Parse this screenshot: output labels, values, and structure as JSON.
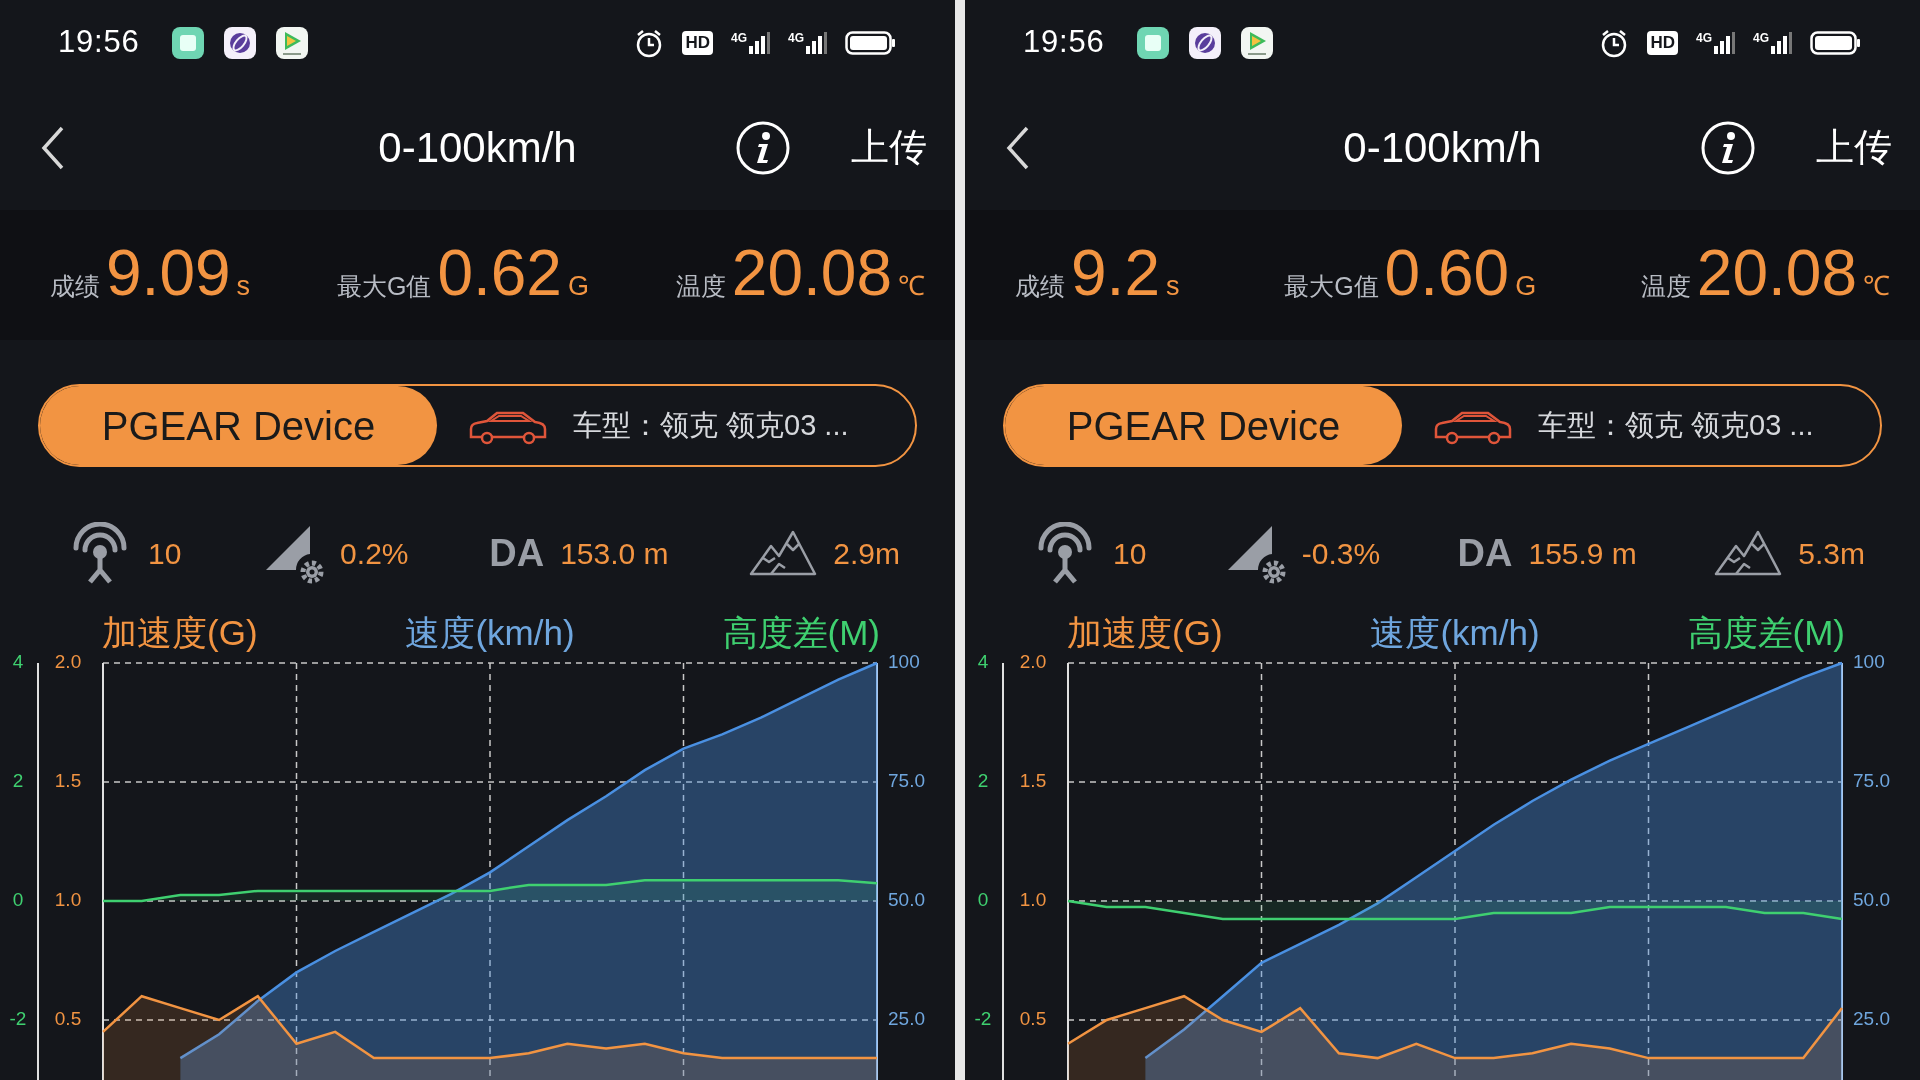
{
  "panels": [
    {
      "status_bar": {
        "time": "19:56",
        "hd_label": "HD",
        "signals": [
          "4G",
          "4G"
        ]
      },
      "header": {
        "title": "0-100km/h",
        "action": "上传"
      },
      "stats": [
        {
          "label": "成绩",
          "value": "9.09",
          "unit": "s"
        },
        {
          "label": "最大G值",
          "value": "0.62",
          "unit": "G"
        },
        {
          "label": "温度",
          "value": "20.08",
          "unit": "℃"
        }
      ],
      "device": {
        "name": "PGEAR Device",
        "car_model": "车型：领克 领克03 ..."
      },
      "metrics": [
        {
          "kind": "satellites",
          "value": "10"
        },
        {
          "kind": "slope",
          "value": "0.2%"
        },
        {
          "kind": "density_altitude",
          "label": "DA",
          "value": "153.0 m"
        },
        {
          "kind": "elevation",
          "value": "2.9m"
        }
      ],
      "chart": {
        "chart_data": {
          "type": "area",
          "grid": true,
          "categories": [
            null,
            null,
            null,
            null,
            null,
            null,
            null,
            null,
            null,
            null,
            null,
            null,
            null,
            null,
            null,
            null,
            null,
            null,
            null,
            null,
            null
          ],
          "ylim": [
            0,
            2
          ],
          "yticks": [
            {
              "value": 2,
              "label": "2.0"
            },
            {
              "value": 1.5,
              "label": "1.5"
            },
            {
              "value": 1,
              "label": "1.0"
            },
            {
              "value": 0.5,
              "label": "0.5"
            }
          ],
          "y2lim": [
            0,
            100
          ],
          "y2ticks": [
            {
              "value": 100,
              "label": "100"
            },
            {
              "value": 75,
              "label": "75.0"
            },
            {
              "value": 50,
              "label": "50.0"
            },
            {
              "value": 25,
              "label": "25.0"
            }
          ],
          "y3lim": [
            -4,
            4
          ],
          "y3ticks": [
            4,
            2,
            0,
            -2
          ],
          "series": [
            {
              "name": "加速度(G)",
              "color": "#f29442",
              "values": [
                0.45,
                0.6,
                0.55,
                0.5,
                0.6,
                0.4,
                0.45,
                0.34,
                0.34,
                0.34,
                0.34,
                0.36,
                0.4,
                0.38,
                0.4,
                0.36,
                0.34,
                0.34,
                0.34,
                0.34,
                0.34
              ]
            },
            {
              "name": "速度(km/h)",
              "color": "#4a90e2",
              "axis": "y2",
              "values": [
                null,
                null,
                17,
                22,
                29,
                35,
                39.5,
                43.5,
                47.5,
                51.5,
                56,
                61.5,
                67,
                72,
                77.5,
                82,
                85,
                88.5,
                92.5,
                96.5,
                100
              ]
            },
            {
              "name": "高度差(M)",
              "color": "#3fd070",
              "axis": "y3",
              "values": [
                0,
                0,
                0.1,
                0.1,
                0.17,
                0.17,
                0.17,
                0.17,
                0.17,
                0.17,
                0.17,
                0.27,
                0.27,
                0.27,
                0.35,
                0.35,
                0.35,
                0.35,
                0.35,
                0.35,
                0.3
              ]
            }
          ]
        }
      }
    },
    {
      "status_bar": {
        "time": "19:56",
        "hd_label": "HD",
        "signals": [
          "4G",
          "4G"
        ]
      },
      "header": {
        "title": "0-100km/h",
        "action": "上传"
      },
      "stats": [
        {
          "label": "成绩",
          "value": "9.2",
          "unit": "s"
        },
        {
          "label": "最大G值",
          "value": "0.60",
          "unit": "G"
        },
        {
          "label": "温度",
          "value": "20.08",
          "unit": "℃"
        }
      ],
      "device": {
        "name": "PGEAR Device",
        "car_model": "车型：领克 领克03 ..."
      },
      "metrics": [
        {
          "kind": "satellites",
          "value": "10"
        },
        {
          "kind": "slope",
          "value": "-0.3%"
        },
        {
          "kind": "density_altitude",
          "label": "DA",
          "value": "155.9 m"
        },
        {
          "kind": "elevation",
          "value": "5.3m"
        }
      ],
      "chart": {
        "chart_data": {
          "type": "area",
          "grid": true,
          "categories": [
            null,
            null,
            null,
            null,
            null,
            null,
            null,
            null,
            null,
            null,
            null,
            null,
            null,
            null,
            null,
            null,
            null,
            null,
            null,
            null,
            null
          ],
          "ylim": [
            0,
            2
          ],
          "yticks": [
            {
              "value": 2,
              "label": "2.0"
            },
            {
              "value": 1.5,
              "label": "1.5"
            },
            {
              "value": 1,
              "label": "1.0"
            },
            {
              "value": 0.5,
              "label": "0.5"
            }
          ],
          "y2lim": [
            0,
            100
          ],
          "y2ticks": [
            {
              "value": 100,
              "label": "100"
            },
            {
              "value": 75,
              "label": "75.0"
            },
            {
              "value": 50,
              "label": "50.0"
            },
            {
              "value": 25,
              "label": "25.0"
            }
          ],
          "y3lim": [
            -4,
            4
          ],
          "y3ticks": [
            4,
            2,
            0,
            -2
          ],
          "series": [
            {
              "name": "加速度(G)",
              "color": "#f29442",
              "values": [
                0.4,
                0.5,
                0.55,
                0.6,
                0.5,
                0.45,
                0.55,
                0.36,
                0.34,
                0.4,
                0.34,
                0.34,
                0.36,
                0.4,
                0.38,
                0.34,
                0.34,
                0.34,
                0.34,
                0.34,
                0.55
              ]
            },
            {
              "name": "速度(km/h)",
              "color": "#4a90e2",
              "axis": "y2",
              "values": [
                null,
                null,
                17,
                23,
                30,
                37,
                41,
                45,
                49.5,
                55,
                60.5,
                66,
                71,
                75.5,
                79.5,
                83,
                86.5,
                90,
                93.5,
                97,
                100
              ]
            },
            {
              "name": "高度差(M)",
              "color": "#3fd070",
              "axis": "y3",
              "values": [
                0,
                -0.1,
                -0.1,
                -0.2,
                -0.3,
                -0.3,
                -0.3,
                -0.3,
                -0.3,
                -0.3,
                -0.3,
                -0.2,
                -0.2,
                -0.2,
                -0.1,
                -0.1,
                -0.1,
                -0.1,
                -0.2,
                -0.2,
                -0.3
              ]
            }
          ]
        }
      }
    }
  ]
}
